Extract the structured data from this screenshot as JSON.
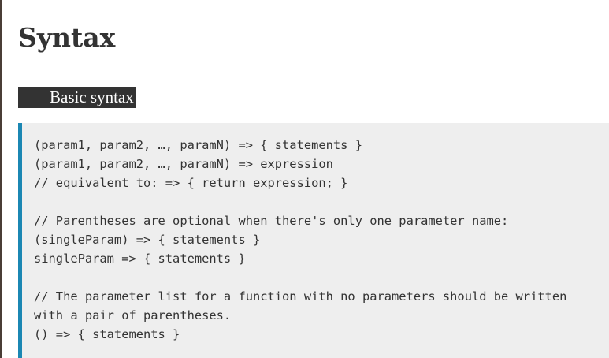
{
  "page": {
    "title": "Syntax",
    "section_heading": "Basic syntax"
  },
  "code": {
    "lines": [
      "(param1, param2, …, paramN) => { statements }",
      "(param1, param2, …, paramN) => expression",
      "// equivalent to: => { return expression; }",
      "",
      "// Parentheses are optional when there's only one parameter name:",
      "(singleParam) => { statements }",
      "singleParam => { statements }",
      "",
      "// The parameter list for a function with no parameters should be written",
      "with a pair of parentheses.",
      "() => { statements }"
    ]
  },
  "colors": {
    "accent_border": "#1b87b3",
    "code_background": "#eeeeee",
    "heading_background": "#333333",
    "text": "#333333"
  }
}
